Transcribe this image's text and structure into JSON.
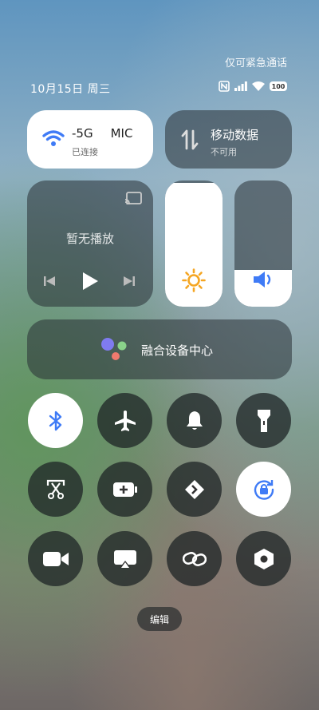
{
  "status": {
    "emergency_text": "仅可紧急通话",
    "date_text": "10月15日 周三",
    "battery_level": "100",
    "icons": [
      "nfc-icon",
      "signal-icon",
      "wifi-status-icon",
      "battery-icon"
    ]
  },
  "wifi": {
    "name": "-5G",
    "name_extra": "MIC",
    "status": "已连接",
    "enabled": true,
    "accent": "#3f7bf6"
  },
  "mobile_data": {
    "title": "移动数据",
    "status": "不可用",
    "enabled": false
  },
  "media": {
    "status": "暂无播放"
  },
  "brightness": {
    "level_percent": 98,
    "icon": "sun-icon",
    "icon_color": "#f5a623"
  },
  "volume": {
    "level_percent": 29,
    "icon": "speaker-icon",
    "icon_color": "#3f7bf6"
  },
  "fusion_center": {
    "label": "融合设备中心"
  },
  "toggles": [
    {
      "id": "bluetooth",
      "icon": "bluetooth-icon",
      "on": true
    },
    {
      "id": "airplane",
      "icon": "airplane-icon",
      "on": false
    },
    {
      "id": "ringer",
      "icon": "bell-icon",
      "on": false
    },
    {
      "id": "flashlight",
      "icon": "flashlight-icon",
      "on": false
    },
    {
      "id": "screenshot",
      "icon": "scissors-screenshot-icon",
      "on": false
    },
    {
      "id": "battery-saver",
      "icon": "battery-saver-icon",
      "on": false
    },
    {
      "id": "nearby-share",
      "icon": "share-diamond-icon",
      "on": false
    },
    {
      "id": "rotation-lock",
      "icon": "rotation-lock-icon",
      "on": true
    },
    {
      "id": "screen-record",
      "icon": "video-camera-icon",
      "on": false
    },
    {
      "id": "cast",
      "icon": "cast-screen-icon",
      "on": false
    },
    {
      "id": "link",
      "icon": "link-icon",
      "on": false
    },
    {
      "id": "settings-hex",
      "icon": "hexagon-settings-icon",
      "on": false
    }
  ],
  "edit_button": {
    "label": "编辑"
  }
}
